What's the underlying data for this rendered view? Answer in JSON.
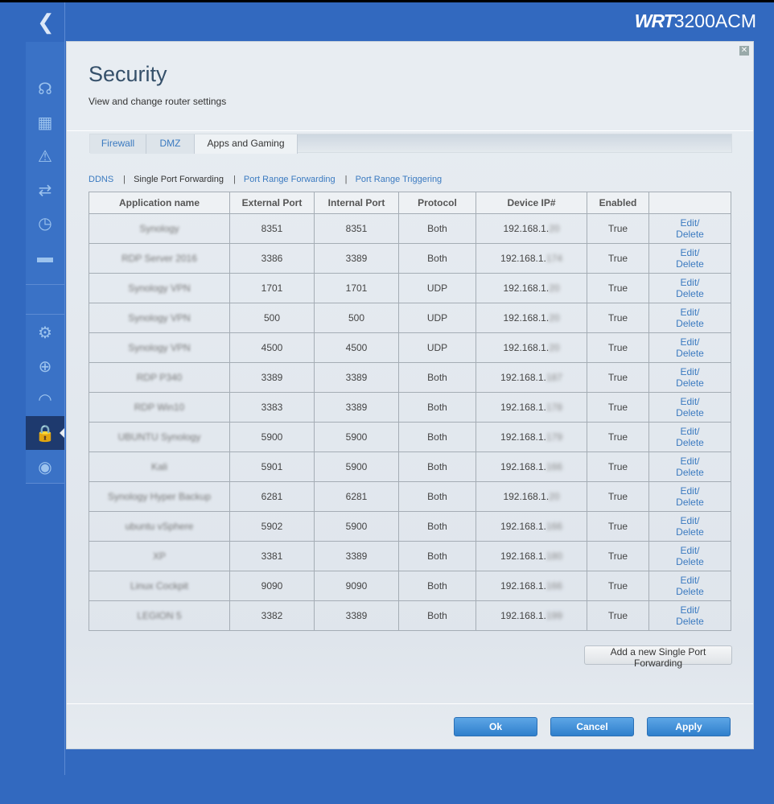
{
  "header": {
    "back_icon": "chevron-left-icon",
    "brand_bold": "WRT",
    "brand_model": "3200ACM"
  },
  "sidebar": {
    "items": [
      {
        "icon": "network-map-icon",
        "glyph": "☊"
      },
      {
        "icon": "external-storage-icon",
        "glyph": "▦"
      },
      {
        "icon": "troubleshooting-icon",
        "glyph": "⚠"
      },
      {
        "icon": "connectivity-icon",
        "glyph": "⇄"
      },
      {
        "icon": "speed-test-icon",
        "glyph": "◷"
      },
      {
        "icon": "usb-icon",
        "glyph": "▬"
      },
      {
        "icon": "settings-gears-icon",
        "glyph": "⚙"
      },
      {
        "icon": "troubleshoot-kit-icon",
        "glyph": "⊕"
      },
      {
        "icon": "wifi-settings-icon",
        "glyph": "◠"
      },
      {
        "icon": "security-shield-icon",
        "glyph": "🔒",
        "active": true
      },
      {
        "icon": "open-source-icon",
        "glyph": "◉"
      }
    ]
  },
  "page": {
    "title": "Security",
    "subtitle": "View and change router settings"
  },
  "tabs": [
    "Firewall",
    "DMZ",
    "Apps and Gaming"
  ],
  "active_tab": "Apps and Gaming",
  "subnav": [
    "DDNS",
    "Single Port Forwarding",
    "Port Range Forwarding",
    "Port Range Triggering"
  ],
  "active_subnav": "Single Port Forwarding",
  "table": {
    "columns": [
      "Application name",
      "External Port",
      "Internal Port",
      "Protocol",
      "Device IP#",
      "Enabled",
      ""
    ],
    "rows": [
      {
        "name": "Synology",
        "ext": "8351",
        "int": "8351",
        "proto": "Both",
        "ip": "192.168.1.",
        "ip_hidden": "20",
        "enabled": "True"
      },
      {
        "name": "RDP Server 2016",
        "ext": "3386",
        "int": "3389",
        "proto": "Both",
        "ip": "192.168.1.",
        "ip_hidden": "174",
        "enabled": "True"
      },
      {
        "name": "Synology VPN",
        "ext": "1701",
        "int": "1701",
        "proto": "UDP",
        "ip": "192.168.1.",
        "ip_hidden": "20",
        "enabled": "True"
      },
      {
        "name": "Synology VPN",
        "ext": "500",
        "int": "500",
        "proto": "UDP",
        "ip": "192.168.1.",
        "ip_hidden": "20",
        "enabled": "True"
      },
      {
        "name": "Synology VPN",
        "ext": "4500",
        "int": "4500",
        "proto": "UDP",
        "ip": "192.168.1.",
        "ip_hidden": "20",
        "enabled": "True"
      },
      {
        "name": "RDP P340",
        "ext": "3389",
        "int": "3389",
        "proto": "Both",
        "ip": "192.168.1.",
        "ip_hidden": "187",
        "enabled": "True"
      },
      {
        "name": "RDP Win10",
        "ext": "3383",
        "int": "3389",
        "proto": "Both",
        "ip": "192.168.1.",
        "ip_hidden": "178",
        "enabled": "True"
      },
      {
        "name": "UBUNTU Synology",
        "ext": "5900",
        "int": "5900",
        "proto": "Both",
        "ip": "192.168.1.",
        "ip_hidden": "179",
        "enabled": "True"
      },
      {
        "name": "Kali",
        "ext": "5901",
        "int": "5900",
        "proto": "Both",
        "ip": "192.168.1.",
        "ip_hidden": "166",
        "enabled": "True"
      },
      {
        "name": "Synology Hyper Backup",
        "ext": "6281",
        "int": "6281",
        "proto": "Both",
        "ip": "192.168.1.",
        "ip_hidden": "20",
        "enabled": "True"
      },
      {
        "name": "ubuntu vSphere",
        "ext": "5902",
        "int": "5900",
        "proto": "Both",
        "ip": "192.168.1.",
        "ip_hidden": "166",
        "enabled": "True"
      },
      {
        "name": "XP",
        "ext": "3381",
        "int": "3389",
        "proto": "Both",
        "ip": "192.168.1.",
        "ip_hidden": "180",
        "enabled": "True"
      },
      {
        "name": "Linux Cockpit",
        "ext": "9090",
        "int": "9090",
        "proto": "Both",
        "ip": "192.168.1.",
        "ip_hidden": "166",
        "enabled": "True"
      },
      {
        "name": "LEGION 5",
        "ext": "3382",
        "int": "3389",
        "proto": "Both",
        "ip": "192.168.1.",
        "ip_hidden": "199",
        "enabled": "True"
      }
    ],
    "edit_label": "Edit/",
    "delete_label": "Delete"
  },
  "add_button": "Add a new Single Port Forwarding",
  "footer": {
    "ok": "Ok",
    "cancel": "Cancel",
    "apply": "Apply"
  },
  "colors": {
    "background": "#3269bf",
    "accent": "#3b7ac0",
    "button": "#2f7fcc"
  }
}
